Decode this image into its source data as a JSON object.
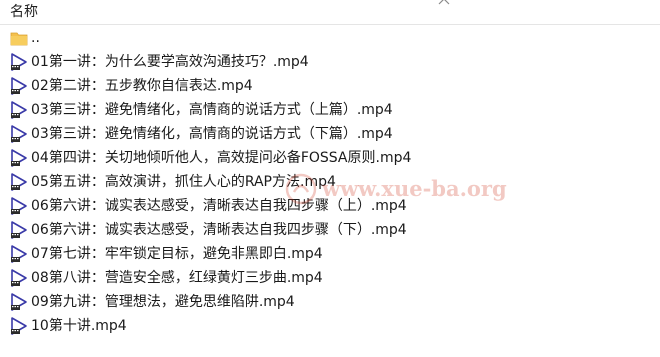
{
  "header": {
    "name_column": "名称"
  },
  "files": [
    {
      "label": "..",
      "icon": "folder-icon"
    },
    {
      "label": "01第一讲：为什么要学高效沟通技巧？.mp4",
      "icon": "video-file-icon"
    },
    {
      "label": "02第二讲：五步教你自信表达.mp4",
      "icon": "video-file-icon"
    },
    {
      "label": "03第三讲：避免情绪化，高情商的说话方式（上篇）.mp4",
      "icon": "video-file-icon"
    },
    {
      "label": "03第三讲：避免情绪化，高情商的说话方式（下篇）.mp4",
      "icon": "video-file-icon"
    },
    {
      "label": "04第四讲：关切地倾听他人，高效提问必备FOSSA原则.mp4",
      "icon": "video-file-icon"
    },
    {
      "label": "05第五讲：高效演讲，抓住人心的RAP方法.mp4",
      "icon": "video-file-icon"
    },
    {
      "label": "06第六讲：诚实表达感受，清晰表达自我四步骤（上）.mp4",
      "icon": "video-file-icon"
    },
    {
      "label": "06第六讲：诚实表达感受，清晰表达自我四步骤（下）.mp4",
      "icon": "video-file-icon"
    },
    {
      "label": "07第七讲：牢牢锁定目标，避免非黑即白.mp4",
      "icon": "video-file-icon"
    },
    {
      "label": "08第八讲：营造安全感，红绿黄灯三步曲.mp4",
      "icon": "video-file-icon"
    },
    {
      "label": "09第九讲：管理想法，避免思维陷阱.mp4",
      "icon": "video-file-icon"
    },
    {
      "label": "10第十讲.mp4",
      "icon": "video-file-icon"
    }
  ],
  "watermark": {
    "text": "www.xue-ba.org"
  },
  "colors": {
    "folder": "#f4c04e",
    "video_icon": "#3a3aa8",
    "header_border": "#e5e5e5"
  }
}
